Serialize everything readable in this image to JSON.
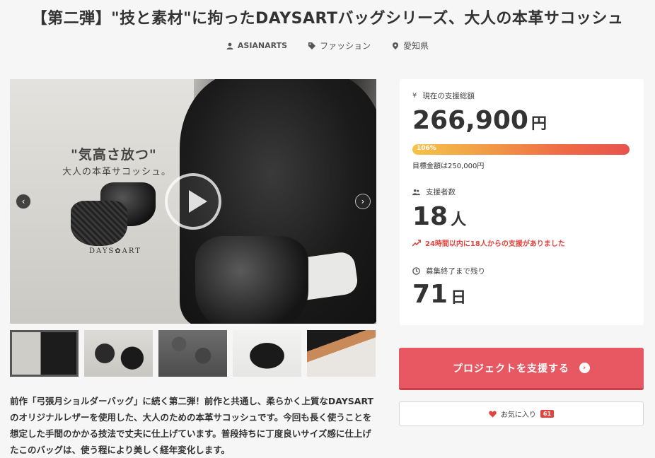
{
  "project": {
    "title": "【第二弾】\"技と素材\"に拘ったDAYSARTバッグシリーズ、大人の本革サコッシュ",
    "author": "ASIANARTS",
    "category": "ファッション",
    "location": "愛知県"
  },
  "hero": {
    "text_line1": "\"気高さ放つ\"",
    "text_line2": "大人の本革サコッシュ。",
    "brand": "DAYS✿ART",
    "prev_arrow": "‹",
    "next_arrow": "›"
  },
  "description": "前作「弓張月ショルダーバッグ」に続く第二弾！前作と共通し、柔らかく上質なDAYSARTのオリジナルレザーを使用した、大人のための本革サコッシュです。今回も長く使うことを想定した手間のかかる技法で丈夫に仕上げています。普段持ちに丁度良いサイズ感に仕上げたこのバッグは、使う程により美しく経年変化します。",
  "stats": {
    "amount_label": "現在の支援総額",
    "amount": "266,900",
    "amount_unit": "円",
    "progress_text": "106%",
    "progress_value": 106,
    "goal": "目標金額は250,000円",
    "backers_label": "支援者数",
    "backers": "18",
    "backers_unit": "人",
    "recent": "24時間以内に18人からの支援がありました",
    "remaining_label": "募集終了まで残り",
    "days": "71",
    "days_unit": "日"
  },
  "actions": {
    "support_label": "プロジェクトを支援する",
    "fav_label": "お気に入り",
    "fav_count": "61"
  },
  "colors": {
    "accent": "#e85862",
    "alert": "#e0453f"
  },
  "icons": [
    "user-icon",
    "tag-icon",
    "location-icon",
    "yen-icon",
    "people-icon",
    "trend-icon",
    "clock-icon",
    "heart-icon",
    "play-icon",
    "chevron-right-icon"
  ]
}
